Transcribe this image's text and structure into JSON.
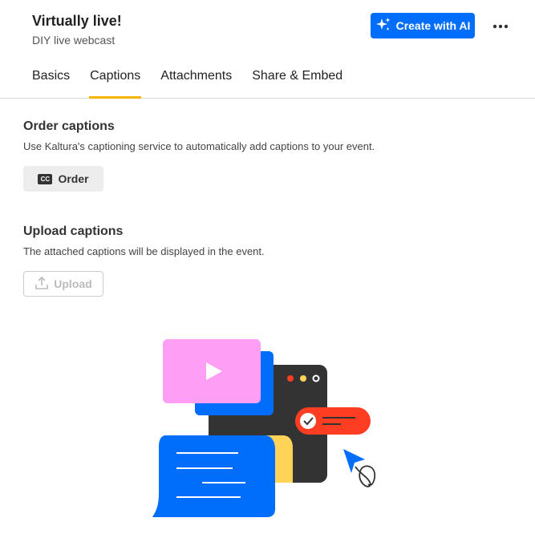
{
  "header": {
    "title": "Virtually live!",
    "subtitle": "DIY live webcast",
    "ai_button_label": "Create with AI",
    "more_icon": "more-horizontal-icon"
  },
  "tabs": [
    {
      "label": "Basics",
      "active": false
    },
    {
      "label": "Captions",
      "active": true
    },
    {
      "label": "Attachments",
      "active": false
    },
    {
      "label": "Share & Embed",
      "active": false
    }
  ],
  "order_section": {
    "title": "Order captions",
    "description": "Use Kaltura's captioning service to automatically add captions to your event.",
    "button_label": "Order",
    "icon_text": "CC"
  },
  "upload_section": {
    "title": "Upload captions",
    "description": "The attached captions will be displayed in the event.",
    "button_label": "Upload",
    "button_disabled": true
  },
  "colors": {
    "accent": "#006efa",
    "tab_indicator": "#f5b400"
  }
}
